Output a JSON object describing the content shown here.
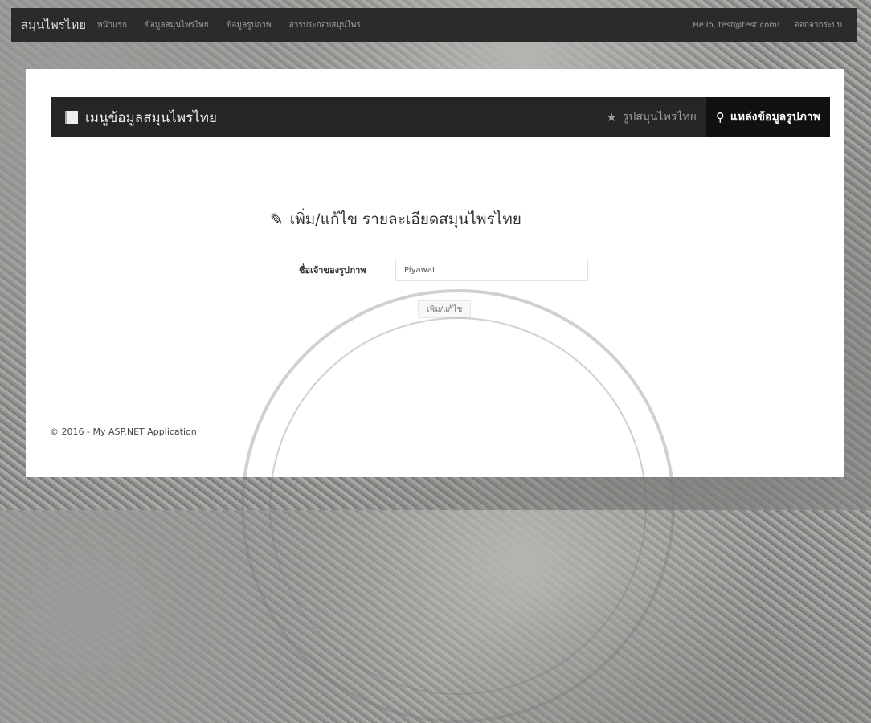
{
  "navbar": {
    "brand": "สมุนไพรไทย",
    "links": [
      "หน้าแรก",
      "ข้อมูลสมุนไพรไทย",
      "ข้อมูลรูปภาพ",
      "สารประกอบสมุนไพร"
    ],
    "hello": "Hello, test@test.com!",
    "logout": "ออกจากระบบ"
  },
  "menubar": {
    "title": "เมนูข้อมูลสมุนไพรไทย",
    "items": [
      {
        "label": "รูปสมุนไพรไทย",
        "icon": "star-icon"
      },
      {
        "label": "แหล่งข้อมูลรูปภาพ",
        "icon": "map-marker-icon"
      }
    ]
  },
  "form": {
    "heading": "เพิ่ม/แก้ไข รายละเอียดสมุนไพรไทย",
    "owner_label": "ชื่อเจ้าของรูปภาพ",
    "owner_value": "Piyawat",
    "submit_label": "เพิ่ม/แก้ไข"
  },
  "footer": {
    "text": "© 2016 - My ASP.NET Application"
  }
}
